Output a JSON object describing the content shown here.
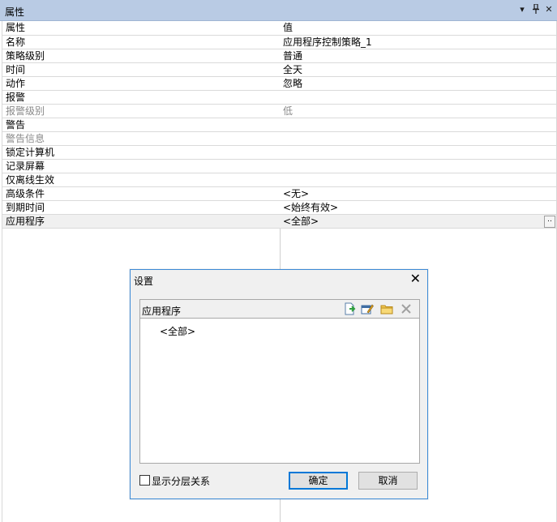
{
  "window": {
    "title": "属性",
    "dropdown_icon": "▾",
    "pin_icon": "Ⲷ",
    "close_icon": "✕"
  },
  "grid": {
    "header": {
      "key": "属性",
      "value": "值"
    },
    "rows": [
      {
        "key": "名称",
        "value": "应用程序控制策略_1",
        "disabled": false
      },
      {
        "key": "策略级别",
        "value": "普通",
        "disabled": false
      },
      {
        "key": "时间",
        "value": "全天",
        "disabled": false
      },
      {
        "key": "动作",
        "value": "忽略",
        "disabled": false
      },
      {
        "key": "报警",
        "value": "",
        "disabled": false
      },
      {
        "key": "报警级别",
        "value": "低",
        "disabled": true
      },
      {
        "key": "警告",
        "value": "",
        "disabled": false
      },
      {
        "key": "警告信息",
        "value": "",
        "disabled": true
      },
      {
        "key": "锁定计算机",
        "value": "",
        "disabled": false
      },
      {
        "key": "记录屏幕",
        "value": "",
        "disabled": false
      },
      {
        "key": "仅离线生效",
        "value": "",
        "disabled": false
      },
      {
        "key": "高级条件",
        "value": "<无>",
        "disabled": false
      },
      {
        "key": "到期时间",
        "value": "<始终有效>",
        "disabled": false
      },
      {
        "key": "应用程序",
        "value": "<全部>",
        "disabled": false,
        "selected": true,
        "button": ".."
      }
    ]
  },
  "dialog": {
    "title": "设置",
    "close": "✕",
    "panel_title": "应用程序",
    "items": [
      "<全部>"
    ],
    "checkbox_label": "显示分层关系",
    "ok_label": "确定",
    "cancel_label": "取消"
  }
}
